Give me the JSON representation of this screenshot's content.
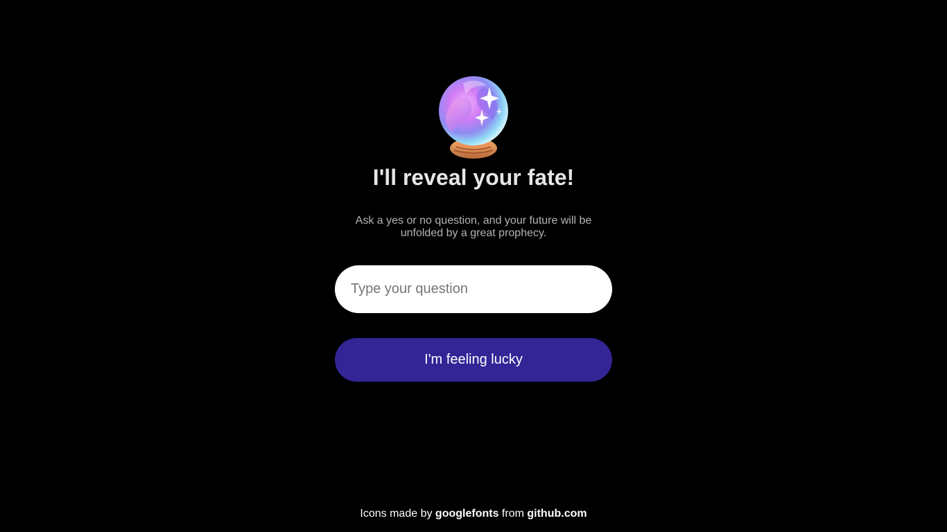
{
  "hero": {
    "icon": "crystal-ball-icon",
    "title": "I'll reveal your fate!",
    "subtitle": "Ask a yes or no question, and your future will be unfolded by a great prophecy."
  },
  "form": {
    "question_placeholder": "Type your question",
    "question_value": "",
    "submit_label": "I'm feeling lucky"
  },
  "footer": {
    "prefix": "Icons made by",
    "author_link": "googlefonts",
    "middle": "from",
    "source_link": "github.com"
  },
  "colors": {
    "background": "#000000",
    "button": "#332596",
    "title": "#e6e6e6",
    "subtitle": "#b4b4b4"
  }
}
